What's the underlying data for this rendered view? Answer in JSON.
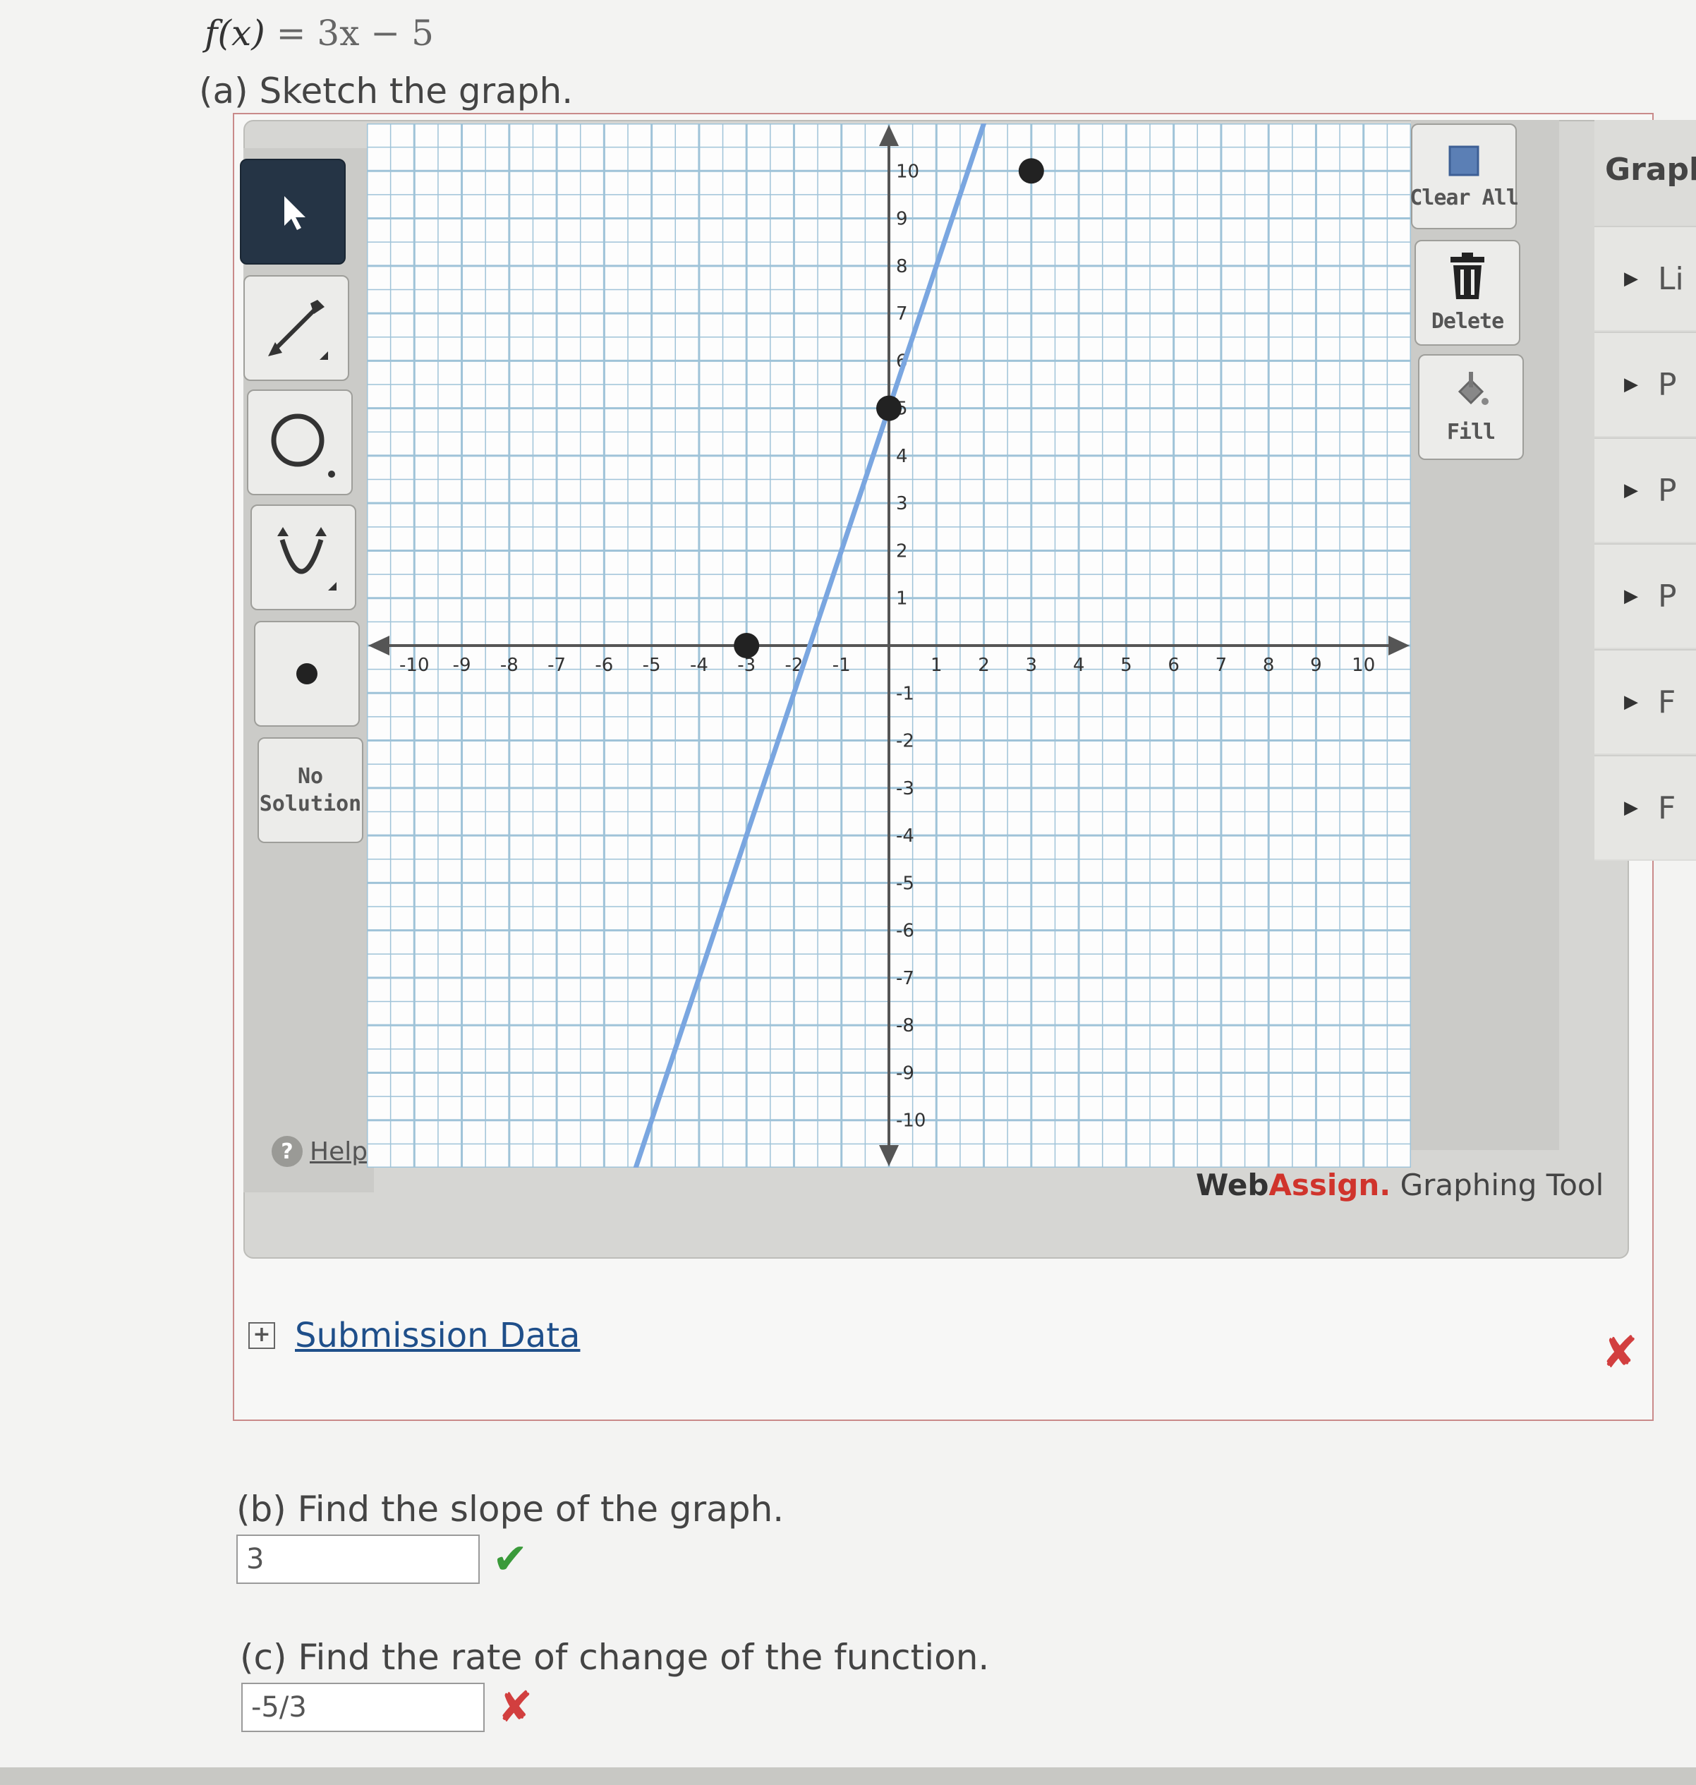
{
  "function_label": {
    "lhs": "f(x)",
    "eq": " = ",
    "rhs": "3x − 5"
  },
  "part_a": {
    "label": "(a) Sketch the graph."
  },
  "toolbar": {
    "no_solution": "No Solution",
    "help": "Help"
  },
  "side_buttons": {
    "clear_all": "Clear All",
    "delete": "Delete",
    "fill": "Fill"
  },
  "brand": {
    "web": "Web",
    "assign": "Assign.",
    "tool": " Graphing Tool"
  },
  "graph_menu": {
    "title": "Graph",
    "items": [
      "Li",
      "P",
      "P",
      "P",
      "F",
      "F"
    ]
  },
  "submission": {
    "label": "Submission Data",
    "status": "✘"
  },
  "part_b": {
    "label": "(b) Find the slope of the graph.",
    "answer": "3",
    "status": "✔"
  },
  "part_c": {
    "label": "(c) Find the rate of change of the function.",
    "answer": "-5/3",
    "status": "✘"
  },
  "colors": {
    "line": "#7aa6e0",
    "point": "#222222",
    "grid": "#9fc3d8",
    "correct": "#3a9a3a",
    "incorrect": "#d23f3f",
    "brand_assign": "#d0342c"
  },
  "graph": {
    "xlim": [
      -11,
      11
    ],
    "ylim": [
      -11,
      11
    ],
    "axis_ticks": [
      -10,
      -9,
      -8,
      -7,
      -6,
      -5,
      -4,
      -3,
      -2,
      -1,
      1,
      2,
      3,
      4,
      5,
      6,
      7,
      8,
      9,
      10
    ],
    "line": {
      "slope": 3,
      "intercept": 5
    },
    "points": [
      [
        0,
        5
      ],
      [
        -3,
        0
      ],
      [
        3,
        10
      ]
    ]
  }
}
